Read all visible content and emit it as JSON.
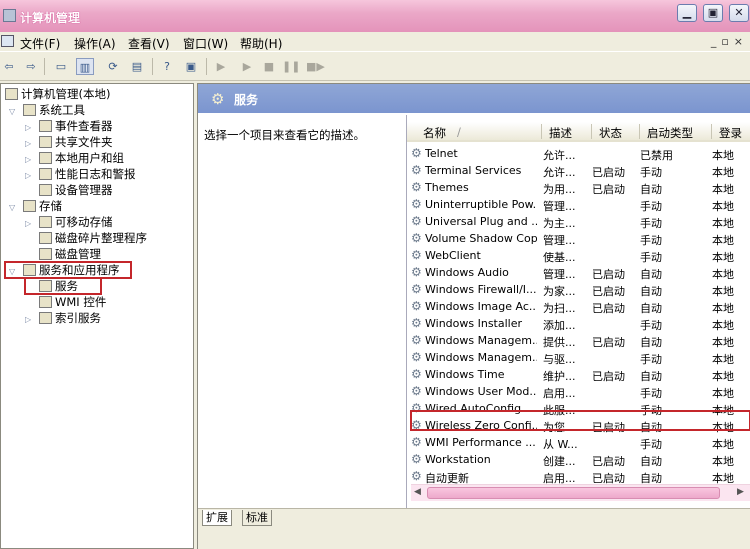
{
  "window": {
    "title": "计算机管理"
  },
  "menu": [
    "文件(F)",
    "操作(A)",
    "查看(V)",
    "窗口(W)",
    "帮助(H)"
  ],
  "tree": {
    "root": "计算机管理(本地)",
    "system_tools": "系统工具",
    "event_viewer": "事件查看器",
    "shared_folders": "共享文件夹",
    "local_users": "本地用户和组",
    "perf_logs": "性能日志和警报",
    "device_manager": "设备管理器",
    "storage": "存储",
    "removable": "可移动存储",
    "defrag": "磁盘碎片整理程序",
    "disk_mgmt": "磁盘管理",
    "services_apps": "服务和应用程序",
    "services": "服务",
    "wmi": "WMI 控件",
    "indexing": "索引服务"
  },
  "right": {
    "header": "服务",
    "description": "选择一个项目来查看它的描述。",
    "columns": {
      "name": "名称",
      "desc": "描述",
      "status": "状态",
      "startup": "启动类型",
      "logon": "登录"
    },
    "rows": [
      {
        "name": "Telnet",
        "desc": "允许...",
        "status": "",
        "startup": "已禁用",
        "logon": "本地"
      },
      {
        "name": "Terminal Services",
        "desc": "允许...",
        "status": "已启动",
        "startup": "手动",
        "logon": "本地"
      },
      {
        "name": "Themes",
        "desc": "为用...",
        "status": "已启动",
        "startup": "自动",
        "logon": "本地"
      },
      {
        "name": "Uninterruptible Pow...",
        "desc": "管理...",
        "status": "",
        "startup": "手动",
        "logon": "本地"
      },
      {
        "name": "Universal Plug and ...",
        "desc": "为主...",
        "status": "",
        "startup": "手动",
        "logon": "本地"
      },
      {
        "name": "Volume Shadow Copy",
        "desc": "管理...",
        "status": "",
        "startup": "手动",
        "logon": "本地"
      },
      {
        "name": "WebClient",
        "desc": "使基...",
        "status": "",
        "startup": "手动",
        "logon": "本地"
      },
      {
        "name": "Windows Audio",
        "desc": "管理...",
        "status": "已启动",
        "startup": "自动",
        "logon": "本地"
      },
      {
        "name": "Windows Firewall/I...",
        "desc": "为家...",
        "status": "已启动",
        "startup": "自动",
        "logon": "本地"
      },
      {
        "name": "Windows Image Ac...",
        "desc": "为扫...",
        "status": "已启动",
        "startup": "自动",
        "logon": "本地"
      },
      {
        "name": "Windows Installer",
        "desc": "添加...",
        "status": "",
        "startup": "手动",
        "logon": "本地"
      },
      {
        "name": "Windows Managem...",
        "desc": "提供...",
        "status": "已启动",
        "startup": "自动",
        "logon": "本地"
      },
      {
        "name": "Windows Managem...",
        "desc": "与驱...",
        "status": "",
        "startup": "手动",
        "logon": "本地"
      },
      {
        "name": "Windows Time",
        "desc": "维护...",
        "status": "已启动",
        "startup": "自动",
        "logon": "本地"
      },
      {
        "name": "Windows User Mod...",
        "desc": "启用...",
        "status": "",
        "startup": "手动",
        "logon": "本地"
      },
      {
        "name": "Wired AutoConfig",
        "desc": "此服...",
        "status": "",
        "startup": "手动",
        "logon": "本地"
      },
      {
        "name": "Wireless Zero Confi...",
        "desc": "为您...",
        "status": "已启动",
        "startup": "自动",
        "logon": "本地"
      },
      {
        "name": "WMI Performance ...",
        "desc": "从 W...",
        "status": "",
        "startup": "手动",
        "logon": "本地"
      },
      {
        "name": "Workstation",
        "desc": "创建...",
        "status": "已启动",
        "startup": "自动",
        "logon": "本地"
      },
      {
        "name": "自动更新",
        "desc": "启用...",
        "status": "已启动",
        "startup": "自动",
        "logon": "本地"
      }
    ],
    "tabs": [
      "扩展",
      "标准"
    ]
  },
  "colors": {
    "accent": "#c4262b",
    "header_blue": "#7b95cf",
    "titlebar_pink": "#eba8c8"
  }
}
